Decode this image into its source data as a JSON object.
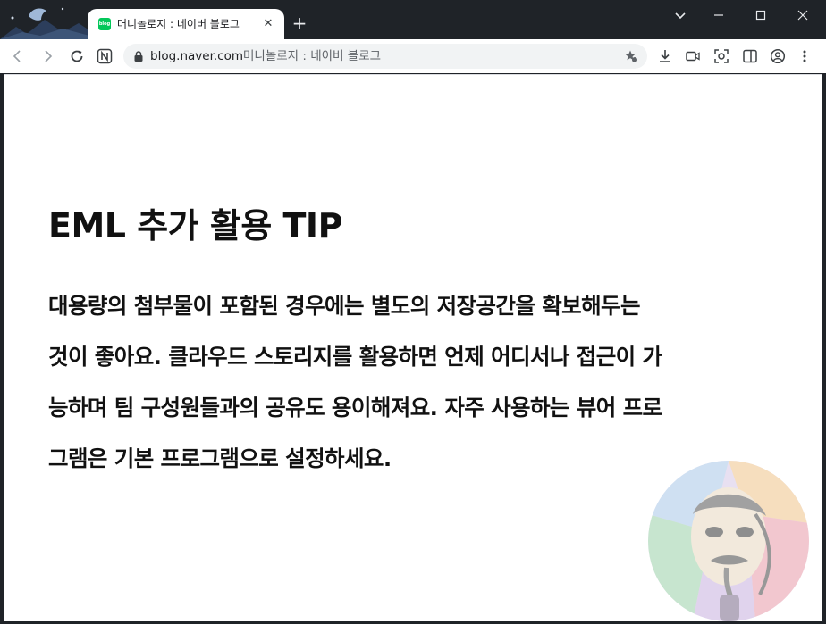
{
  "tab": {
    "favicon_text": "blog",
    "title": "머니놀로지 : 네이버 블로그",
    "close_glyph": "✕"
  },
  "new_tab_glyph": "+",
  "window_controls": {
    "dropdown_glyph": "⌄",
    "minimize_glyph": "—",
    "maximize_glyph": "☐",
    "close_glyph": "✕"
  },
  "address_bar": {
    "host": "blog.naver.com",
    "page_title": "머니놀로지 : 네이버 블로그"
  },
  "toolbar_icons": [
    "back-icon",
    "forward-icon",
    "reload-icon",
    "naver-n-icon",
    "lock-icon",
    "bookmark-star-icon",
    "download-icon",
    "video-icon",
    "screenshot-icon",
    "split-view-icon",
    "profile-icon",
    "menu-icon"
  ],
  "content": {
    "heading": "EML 추가 활용 TIP",
    "paragraph_lines": [
      "대용량의 첨부물이 포함된 경우에는 별도의 저장공간을 확보해두는",
      "것이 좋아요. 클라우드 스토리지를 활용하면 언제 어디서나 접근이 가",
      "능하며 팀 구성원들과의 공유도 용이해져요. 자주 사용하는 뷰어 프로",
      "그램은 기본 프로그램으로 설정하세요."
    ]
  },
  "colors": {
    "frame": "#1f2328",
    "tab_active": "#ffffff",
    "omnibox": "#f1f3f4",
    "naver_green": "#03c75a",
    "text": "#111111"
  }
}
